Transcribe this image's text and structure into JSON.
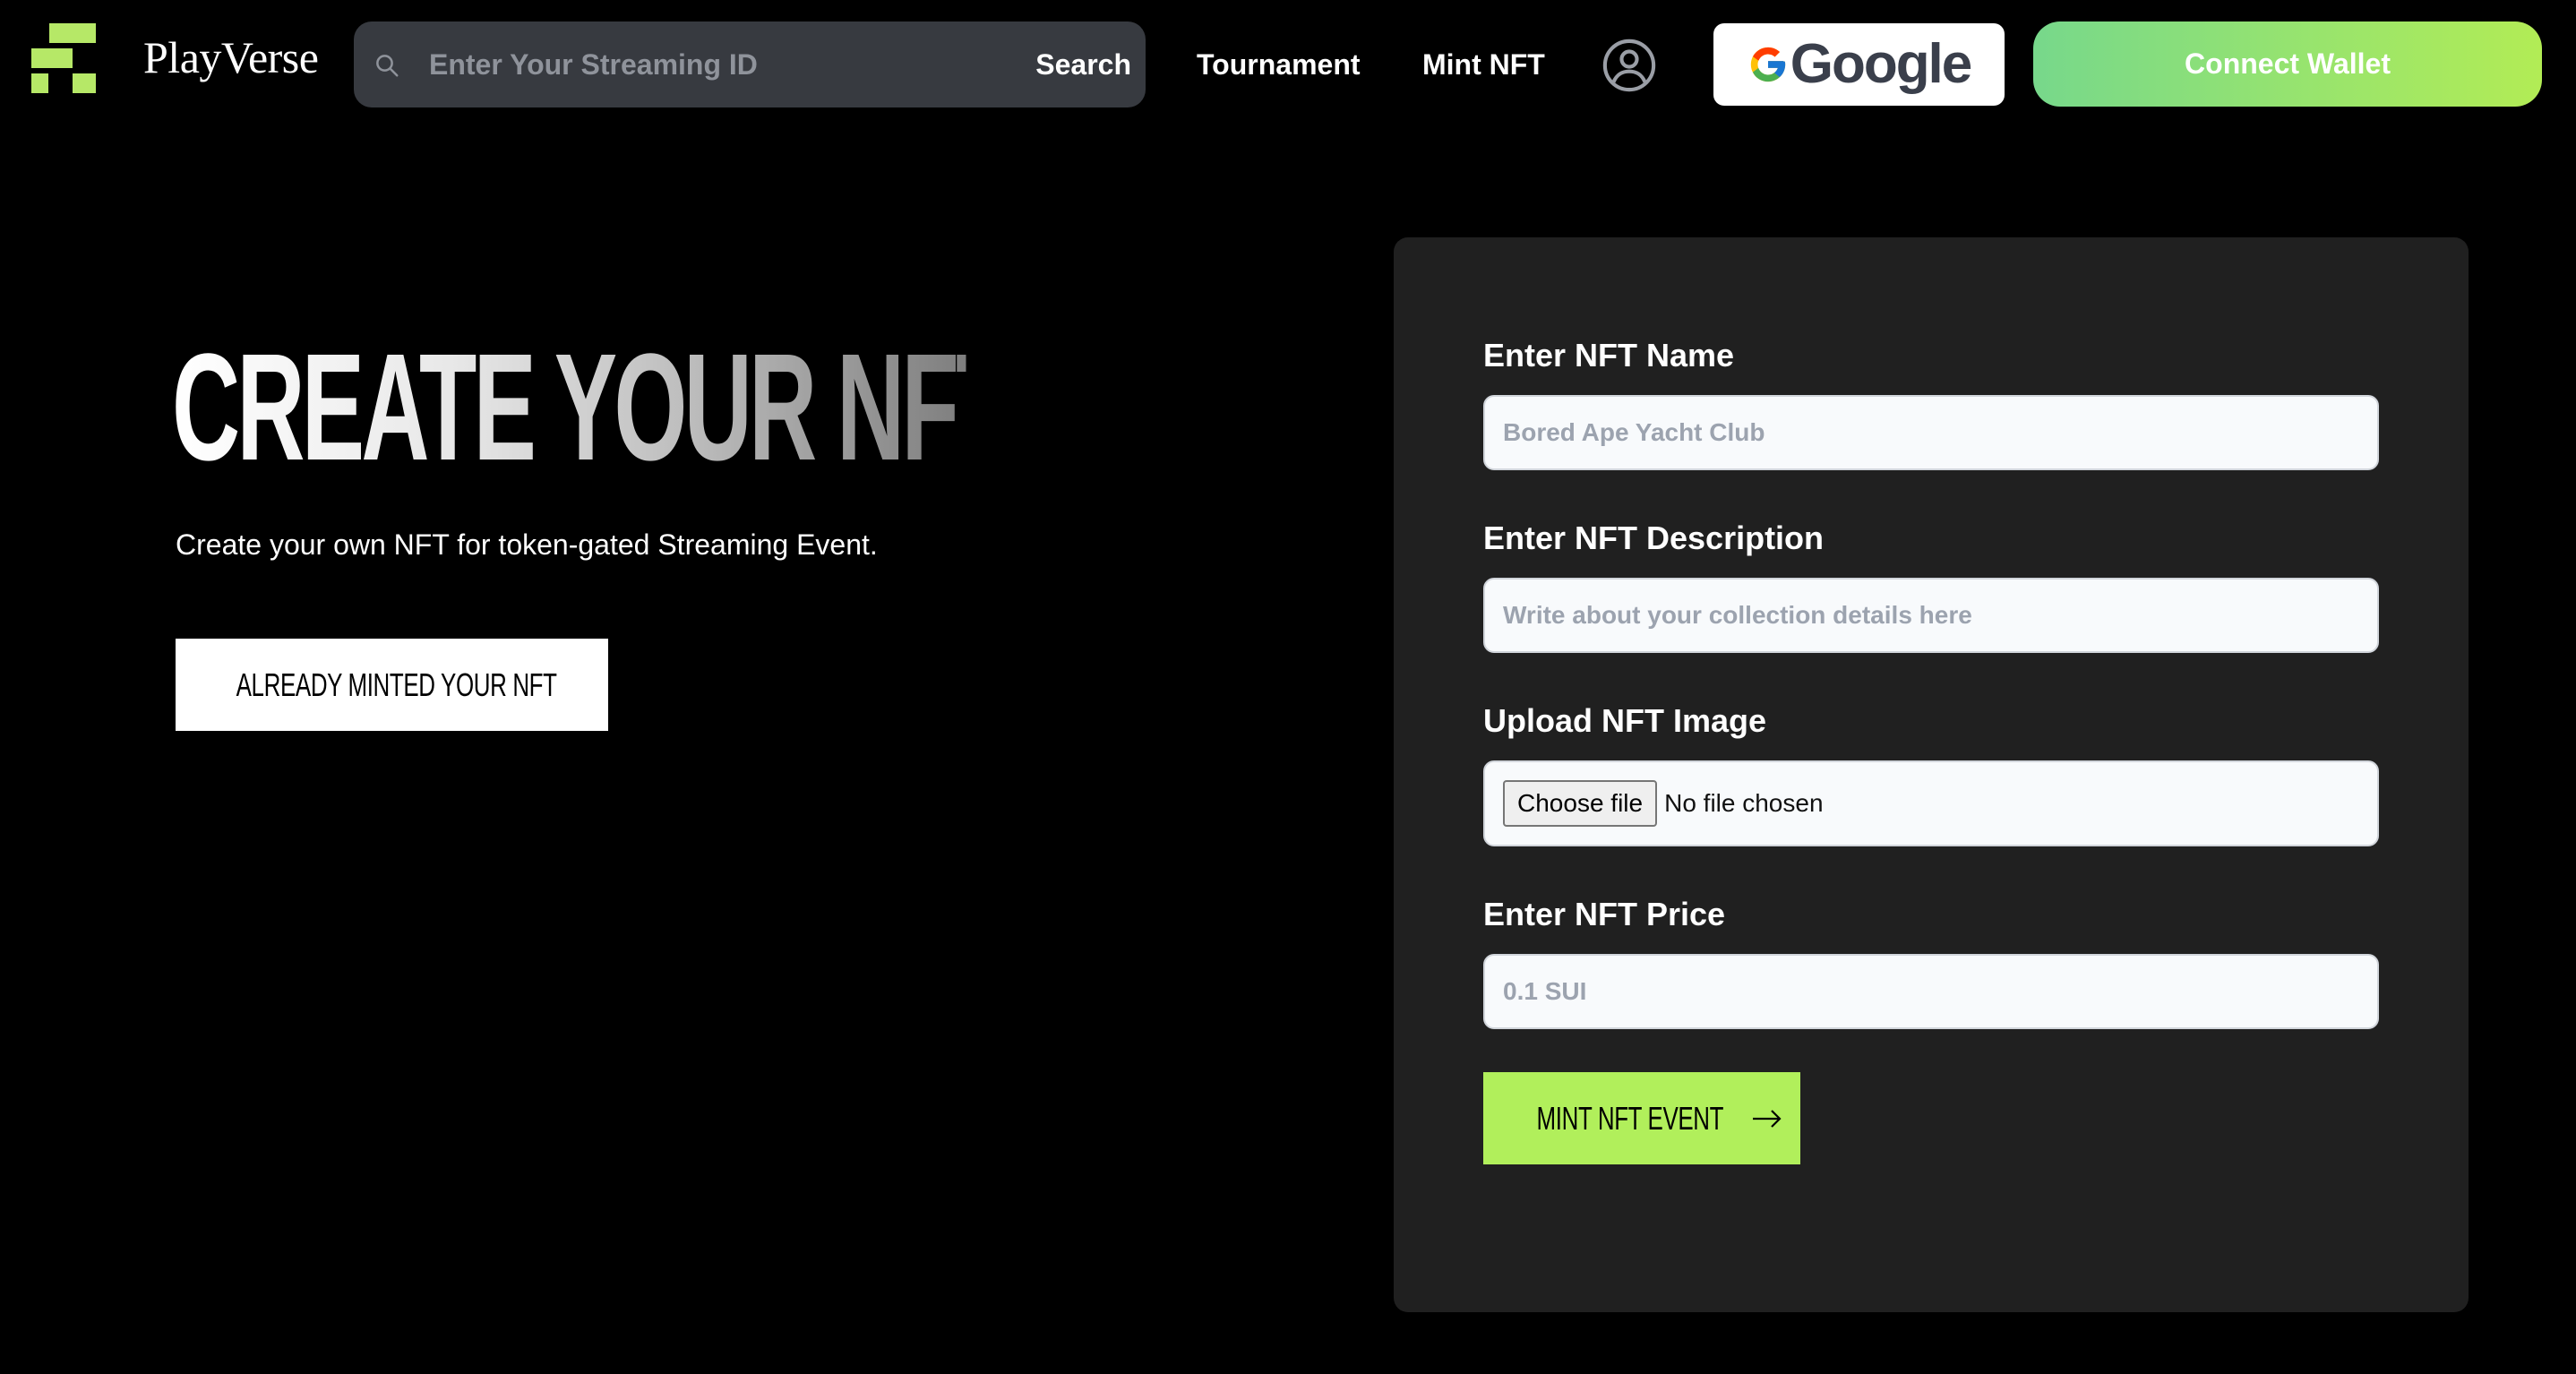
{
  "brand": {
    "name": "PlayVerse",
    "logo_color": "#b6e867"
  },
  "navbar": {
    "search": {
      "placeholder": "Enter Your Streaming ID",
      "value": "",
      "button_label": "Search",
      "icon": "search-icon"
    },
    "links": [
      {
        "label": "Tournament"
      },
      {
        "label": "Mint NFT"
      }
    ],
    "profile_icon": "user-circle-icon",
    "google_button": {
      "label": "Google",
      "icon": "google-g-icon"
    },
    "connect_wallet": {
      "label": "Connect Wallet",
      "gradient": [
        "#77d88b",
        "#b2ec55"
      ]
    }
  },
  "hero": {
    "title": "CREATE YOUR NFT",
    "subtitle": "Create your own NFT for token-gated Streaming Event.",
    "cta_label": "ALREADY MINTED YOUR NFT",
    "cta_icon": "arrow-right-icon"
  },
  "form": {
    "fields": [
      {
        "label": "Enter NFT Name",
        "placeholder": "Bored Ape Yacht Club",
        "value": ""
      },
      {
        "label": "Enter NFT Description",
        "placeholder": "Write about your collection details here",
        "value": ""
      },
      {
        "label": "Upload NFT Image",
        "file_button": "Choose file",
        "file_status": "No file chosen"
      },
      {
        "label": "Enter NFT Price",
        "placeholder": "0.1 SUI",
        "value": ""
      }
    ],
    "submit_label": "MINT NFT EVENT",
    "submit_icon": "arrow-right-icon",
    "accent_color": "#b1ef5b",
    "card_color": "#202020"
  }
}
